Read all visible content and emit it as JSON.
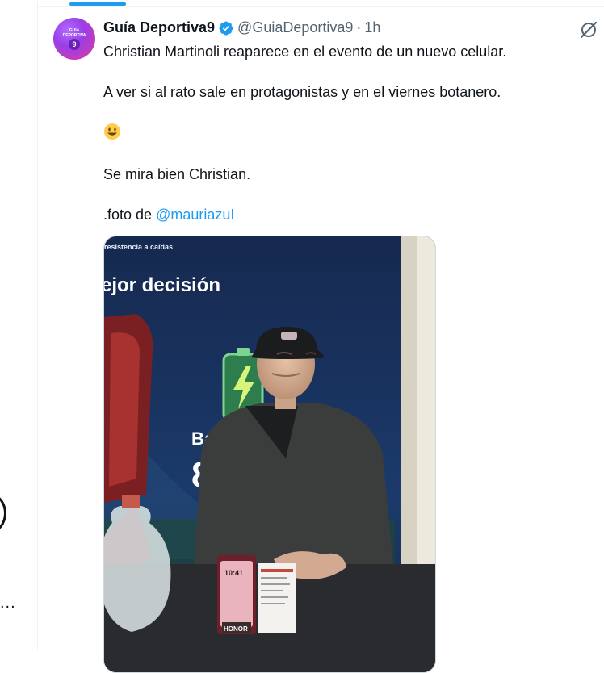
{
  "tweet": {
    "author_name": "Guía Deportiva9",
    "handle": "@GuiaDeportiva9",
    "separator": "·",
    "time": "1h",
    "avatar_text": [
      "GUIA",
      "DEPORTIVA",
      "9"
    ],
    "line1": "Christian Martinoli reaparece en el evento de un nuevo celular.",
    "line2": "A ver si al rato sale en protagonistas y en el viernes botanero.",
    "line4": "Se mira bien Christian.",
    "line5_prefix": ".foto de ",
    "line5_mention": "@mauriazuI",
    "emoji": "smiling-face-icon"
  },
  "photo": {
    "banner_small": "resistencia a caídas",
    "banner_big": "ejor decisión",
    "banner_letters": "Ba",
    "banner_number": "8",
    "phone_brand": "HONOR",
    "phone_time": "10:41"
  },
  "left_rail": {
    "more": "..."
  },
  "colors": {
    "accent": "#1d9bf0",
    "text": "#0f1419",
    "muted": "#536471"
  }
}
